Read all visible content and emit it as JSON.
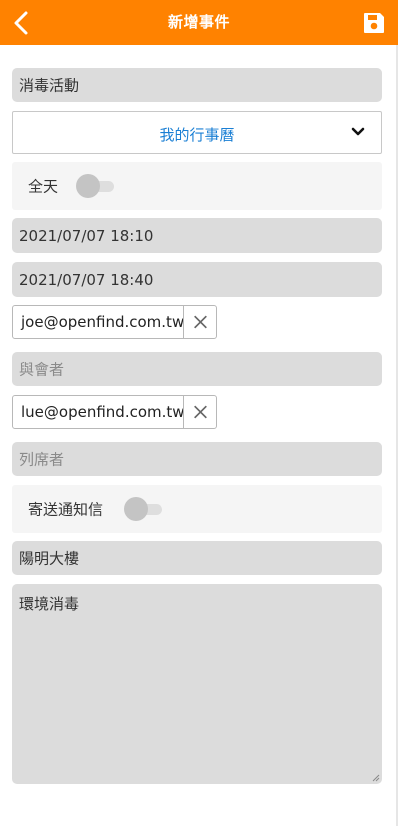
{
  "header": {
    "title": "新增事件",
    "back_icon": "chevron-left-icon",
    "save_icon": "floppy-disk-icon",
    "bg_color": "#ff8200"
  },
  "form": {
    "subject": "消毒活動",
    "calendar": {
      "selected": "我的行事曆",
      "color": "#1a7fd4"
    },
    "all_day": {
      "label": "全天",
      "on": false
    },
    "start": "2021/07/07 18:10",
    "end": "2021/07/07 18:40",
    "attendees": [
      "joe@openfind.com.tw"
    ],
    "attendees_placeholder": "與會者",
    "optional_attendees": [
      "lue@openfind.com.tw"
    ],
    "optional_placeholder": "列席者",
    "send_notice": {
      "label": "寄送通知信",
      "on": false
    },
    "location": "陽明大樓",
    "description": "環境消毒"
  }
}
